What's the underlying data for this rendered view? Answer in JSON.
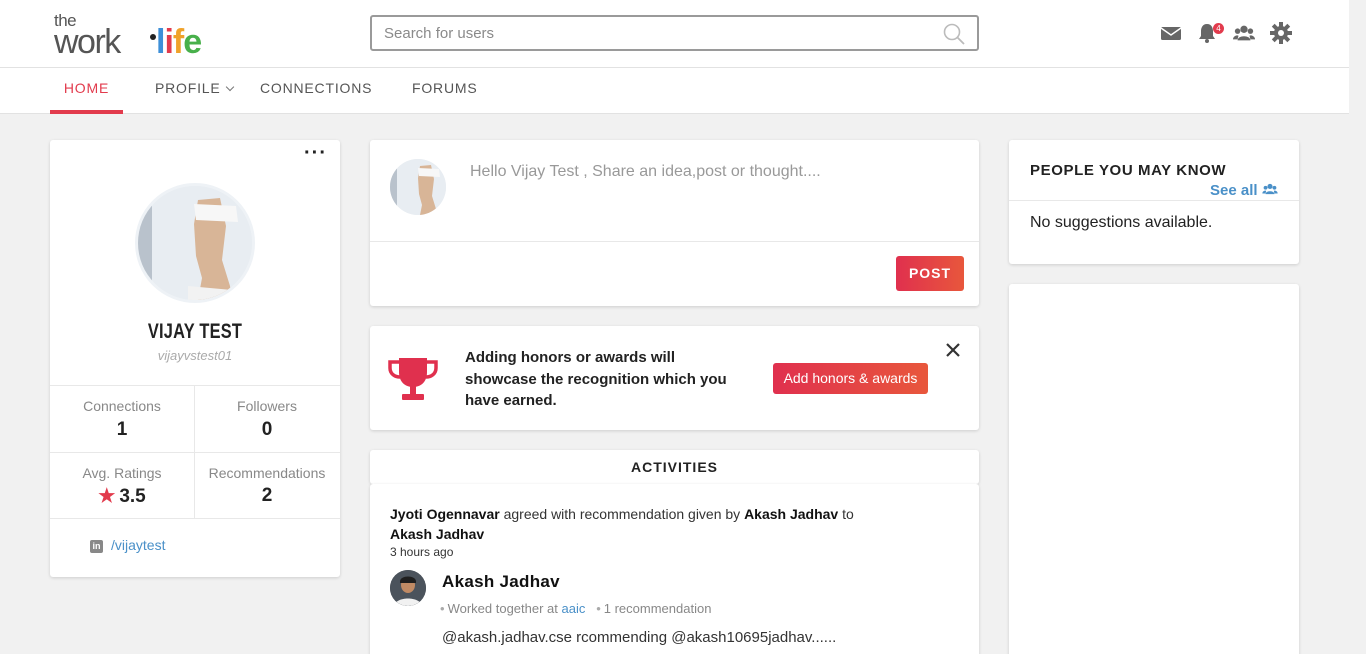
{
  "logo": {
    "line1": "the",
    "line2": "work",
    "line3": "life"
  },
  "search": {
    "placeholder": "Search for users"
  },
  "header_icons": {
    "notifications_badge": "4"
  },
  "nav": {
    "home": "HOME",
    "profile": "PROFILE",
    "connections": "CONNECTIONS",
    "forums": "FORUMS"
  },
  "profile": {
    "name": "VIJAY TEST",
    "username": "vijayvstest01",
    "stats": [
      {
        "label": "Connections",
        "value": "1"
      },
      {
        "label": "Followers",
        "value": "0"
      },
      {
        "label": "Avg. Ratings",
        "value": "3.5"
      },
      {
        "label": "Recommendations",
        "value": "2"
      }
    ],
    "linkedin": "/vijaytest"
  },
  "post": {
    "placeholder": "Hello Vijay Test , Share an idea,post or thought....",
    "button": "POST"
  },
  "honors": {
    "text": "Adding honors or awards will showcase the recognition which you have earned.",
    "button": "Add honors & awards"
  },
  "activities": {
    "title": "ACTIVITIES",
    "item": {
      "actor": "Jyoti Ogennavar",
      "verb": " agreed with recommendation given by ",
      "giver": "Akash Jadhav",
      "to": " to ",
      "receiver": "Akash Jadhav",
      "time": "3 hours ago",
      "name": "Akash Jadhav",
      "meta_prefix": "Worked together at ",
      "meta_company": "aaic",
      "meta_recs": "1 recommendation",
      "body": "@akash.jadhav.cse rcommending @akash10695jadhav......"
    }
  },
  "people": {
    "title": "PEOPLE YOU MAY KNOW",
    "see_all": "See all",
    "empty": "No suggestions available."
  },
  "colors": {
    "accent": "#e23b4d",
    "link": "#4a90c8"
  }
}
